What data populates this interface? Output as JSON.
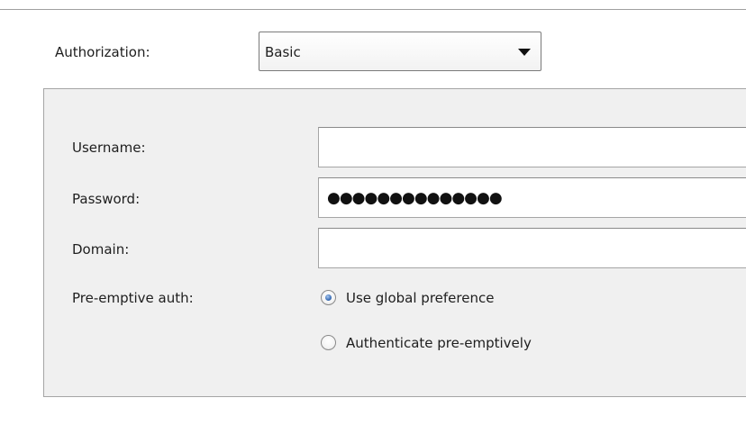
{
  "authorization": {
    "label": "Authorization:",
    "selected": "Basic"
  },
  "credentials": {
    "username": {
      "label": "Username:",
      "value": ""
    },
    "password": {
      "label": "Password:",
      "masked_value": "●●●●●●●●●●●●●●"
    },
    "domain": {
      "label": "Domain:",
      "value": ""
    }
  },
  "preemptive": {
    "label": "Pre-emptive auth:",
    "options": [
      {
        "label": "Use global preference",
        "selected": true
      },
      {
        "label": "Authenticate pre-emptively",
        "selected": false
      }
    ]
  },
  "icons": {
    "dropdown": "chevron-down-icon",
    "radio_selected": "radio-selected-icon",
    "radio_unselected": "radio-unselected-icon"
  },
  "colors": {
    "group_background": "#f0f0f0",
    "field_border": "#a5a5a5",
    "radio_accent": "#3d6fb6"
  }
}
